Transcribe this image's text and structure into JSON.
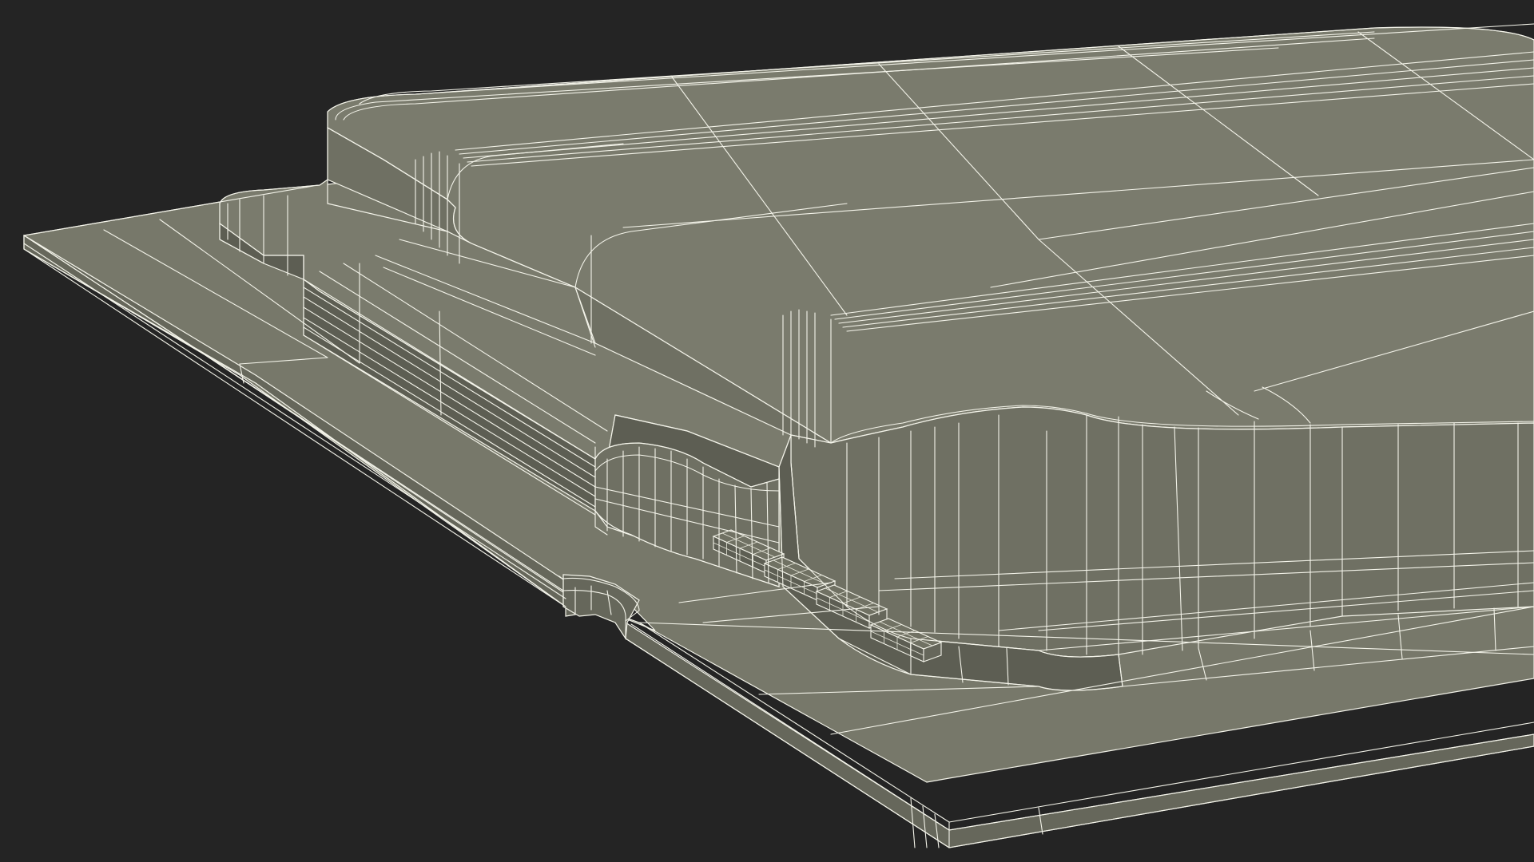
{
  "viewport": {
    "background_color": "#242424",
    "wire_color": "#f4f4ea"
  },
  "model": {
    "surface_colors": {
      "top": "#7a7b6d",
      "top_side": "#6f7063",
      "side_shadow": "#5d5e53",
      "board_top": "#77786a",
      "board_edge": "#66675b",
      "chip": "#707163"
    },
    "components": [
      {
        "label_icon": "smd-component-icon"
      },
      {
        "label_icon": "smd-component-icon"
      },
      {
        "label_icon": "smd-component-icon"
      },
      {
        "label_icon": "smd-component-icon"
      }
    ]
  }
}
